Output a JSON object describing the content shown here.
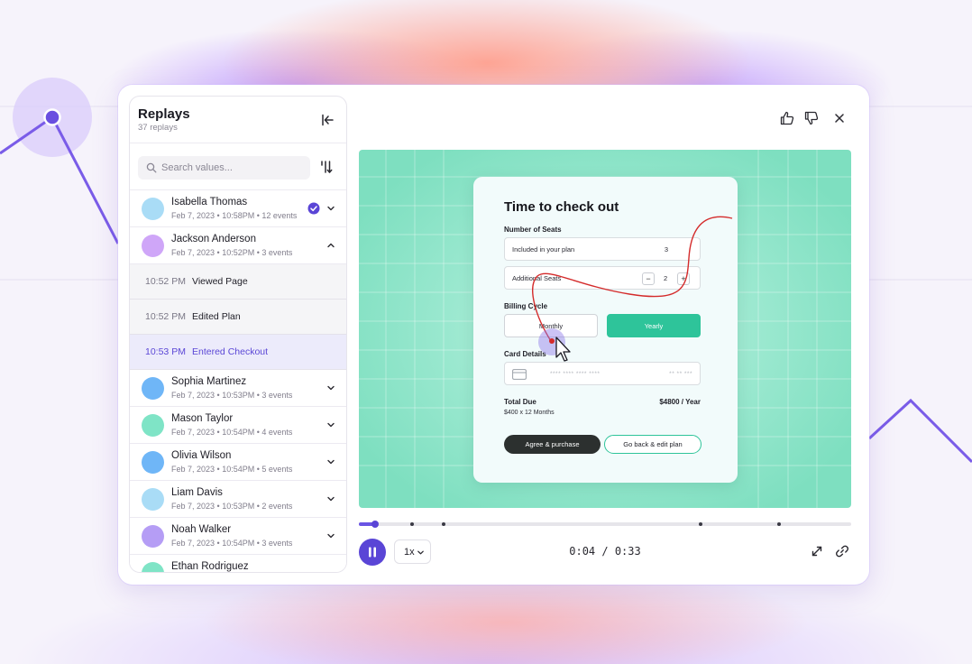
{
  "sidebar": {
    "title": "Replays",
    "count": "37 replays",
    "search_placeholder": "Search values...",
    "items": [
      {
        "name": "Isabella Thomas",
        "meta": "Feb 7, 2023 • 10:58PM • 12 events",
        "color": "#a9dcf6",
        "checked": true,
        "expanded": false
      },
      {
        "name": "Jackson Anderson",
        "meta": "Feb 7, 2023 • 10:52PM • 3 events",
        "color": "#cfa6f8",
        "checked": false,
        "expanded": true
      },
      {
        "name": "Sophia Martinez",
        "meta": "Feb 7, 2023 • 10:53PM • 3 events",
        "color": "#6fb6f7",
        "checked": false,
        "expanded": false
      },
      {
        "name": "Mason Taylor",
        "meta": "Feb 7, 2023 • 10:54PM • 4 events",
        "color": "#7fe4c6",
        "checked": false,
        "expanded": false
      },
      {
        "name": "Olivia Wilson",
        "meta": "Feb 7, 2023 • 10:54PM • 5 events",
        "color": "#6fb6f7",
        "checked": false,
        "expanded": false
      },
      {
        "name": "Liam Davis",
        "meta": "Feb 7, 2023 • 10:53PM • 2 events",
        "color": "#a9dcf6",
        "checked": false,
        "expanded": false
      },
      {
        "name": "Noah Walker",
        "meta": "Feb 7, 2023 • 10:54PM • 3 events",
        "color": "#b59df5",
        "checked": false,
        "expanded": false
      },
      {
        "name": "Ethan Rodriguez",
        "meta": "",
        "color": "#7fe4c6",
        "checked": false,
        "expanded": false
      }
    ],
    "events": [
      {
        "time": "10:52 PM",
        "label": "Viewed Page",
        "active": false
      },
      {
        "time": "10:52 PM",
        "label": "Edited Plan",
        "active": false
      },
      {
        "time": "10:53 PM",
        "label": "Entered Checkout",
        "active": true
      }
    ]
  },
  "checkout": {
    "title": "Time to check out",
    "seats_label": "Number of Seats",
    "included_label": "Included in your plan",
    "included_value": "3",
    "additional_label": "Additional Seats",
    "additional_value": "2",
    "minus": "−",
    "plus": "+",
    "billing_label": "Billing Cycle",
    "monthly": "Monthly",
    "yearly": "Yearly",
    "card_label": "Card Details",
    "card_number": "**** **** **** ****",
    "card_expiry": "** ** ***",
    "total_label": "Total Due",
    "total_value": "$4800 / Year",
    "total_sub": "$400 x 12 Months",
    "agree": "Agree & purchase",
    "back": "Go back & edit plan"
  },
  "player": {
    "progress": 0.033,
    "markers": [
      0.108,
      0.172,
      0.694,
      0.853
    ],
    "speed": "1x",
    "time": "0:04 / 0:33"
  },
  "icons": {
    "collapse": "collapse-left-icon",
    "sort": "sort-icon",
    "thumbs_up": "thumbs-up-icon",
    "thumbs_down": "thumbs-down-icon",
    "close": "close-icon",
    "pause": "pause-icon",
    "expand": "expand-icon",
    "link": "link-icon"
  },
  "colors": {
    "accent": "#5a45d6",
    "mint": "#2ec49a",
    "cursor_path": "#d42b2b"
  }
}
